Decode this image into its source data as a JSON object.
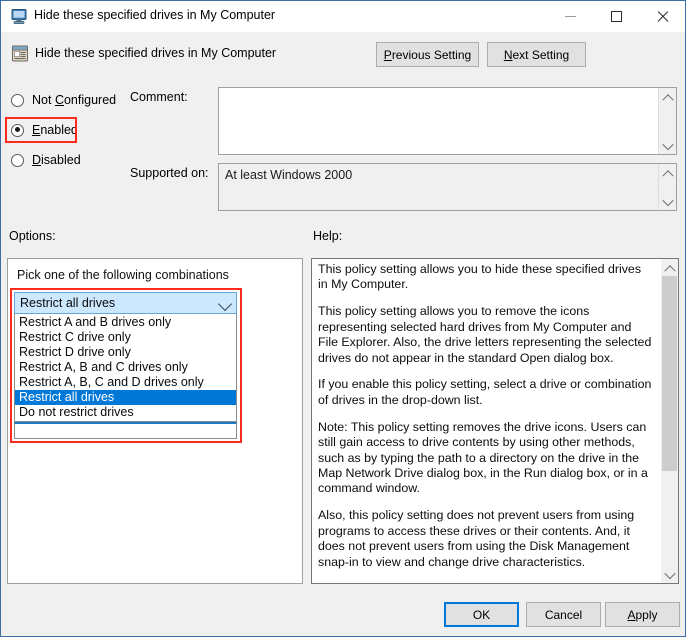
{
  "window": {
    "title": "Hide these specified drives in My Computer",
    "title_icon": "computer-icon",
    "minimize_label": "—",
    "maximize_label": "□",
    "close_label": "✕"
  },
  "header": {
    "policy_icon": "policy-setting-icon",
    "policy_title": "Hide these specified drives in My Computer",
    "previous_button": "Previous Setting",
    "next_button": "Next Setting"
  },
  "state": {
    "not_configured_label": "Not Configured",
    "enabled_label": "Enabled",
    "disabled_label": "Disabled",
    "selected": "Enabled"
  },
  "fields": {
    "comment_label": "Comment:",
    "comment_value": "",
    "supported_label": "Supported on:",
    "supported_value": "At least Windows 2000"
  },
  "sections": {
    "options_label": "Options:",
    "help_label": "Help:"
  },
  "options": {
    "pick_label": "Pick one of the following combinations",
    "combo_value": "Restrict all drives",
    "dropdown_items": [
      "Restrict A and B drives only",
      "Restrict C drive only",
      "Restrict D drive only",
      "Restrict A, B and C drives only",
      "Restrict A, B, C and D drives only",
      "Restrict all drives",
      "Do not restrict drives"
    ],
    "selected_index": 5
  },
  "help": {
    "paragraphs": [
      "This policy setting allows you to hide these specified drives in My Computer.",
      "This policy setting allows you to remove the icons representing selected hard drives from My Computer and File Explorer. Also, the drive letters representing the selected drives do not appear in the standard Open dialog box.",
      "If you enable this policy setting, select a drive or combination of drives in the drop-down list.",
      "Note: This policy setting removes the drive icons. Users can still gain access to drive contents by using other methods, such as by typing the path to a directory on the drive in the Map Network Drive dialog box, in the Run dialog box, or in a command window.",
      "Also, this policy setting does not prevent users from using programs to access these drives or their contents. And, it does not prevent users from using the Disk Management snap-in to view and change drive characteristics."
    ]
  },
  "footer": {
    "ok_label": "OK",
    "cancel_label": "Cancel",
    "apply_label": "Apply"
  },
  "colors": {
    "accent": "#0078d7",
    "highlight_box": "#ff2a1e",
    "combo_background": "#cce8ff",
    "window_background": "#f0f0f0"
  }
}
